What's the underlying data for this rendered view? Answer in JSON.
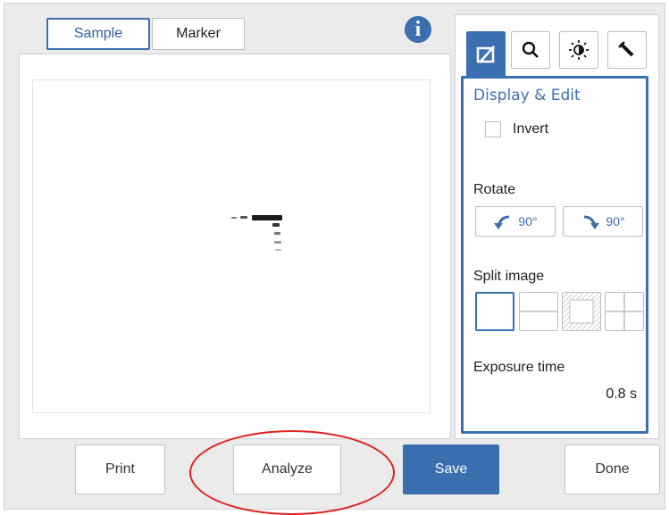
{
  "tabs": {
    "sample": "Sample",
    "marker": "Marker"
  },
  "info": {
    "label": "i"
  },
  "tools": [
    "display-edit",
    "zoom",
    "brightness",
    "marker"
  ],
  "settings": {
    "title": "Display & Edit",
    "invert_label": "Invert",
    "invert_checked": false,
    "rotate_label": "Rotate",
    "rotate_left_label": "90°",
    "rotate_right_label": "90°",
    "split_label": "Split image",
    "split_options": [
      "none",
      "horizontal",
      "frame",
      "quad"
    ],
    "split_selected": "none",
    "exposure_label": "Exposure time",
    "exposure_value": "0.8 s"
  },
  "buttons": {
    "print": "Print",
    "analyze": "Analyze",
    "save": "Save",
    "done": "Done"
  },
  "colors": {
    "accent": "#3c6fb0",
    "highlight": "#e02020"
  }
}
